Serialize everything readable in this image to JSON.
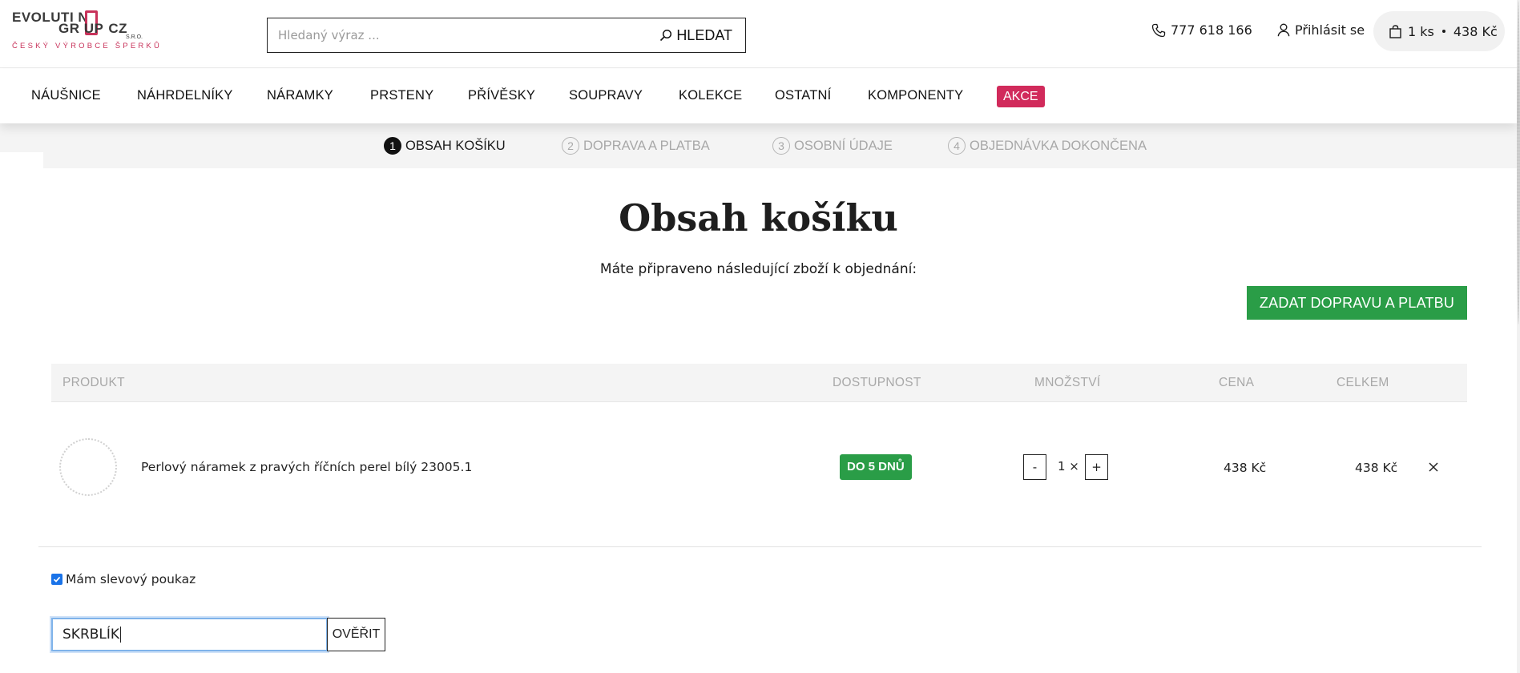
{
  "header": {
    "logo": {
      "line1": "EVOLUTI N",
      "line2_a": "GR UP",
      "line2_b": "CZ",
      "sro": "S.R.O.",
      "tagline": "ČESKÝ VÝROBCE ŠPERKŮ"
    },
    "search": {
      "placeholder": "Hledaný výraz ...",
      "value": "",
      "button_label": "HLEDAT"
    },
    "phone": "777 618 166",
    "login_label": "Přihlásit se",
    "cart": {
      "count": "1 ks",
      "total": "438 Kč"
    }
  },
  "nav": {
    "items": [
      "NÁUŠNICE",
      "NÁHRDELNÍKY",
      "NÁRAMKY",
      "PRSTENY",
      "PŘÍVĚSKY",
      "SOUPRAVY",
      "KOLEKCE",
      "OSTATNÍ",
      "KOMPONENTY"
    ],
    "sale_label": "AKCE"
  },
  "steps": [
    {
      "num": "1",
      "label": "OBSAH KOŠÍKU",
      "active": true
    },
    {
      "num": "2",
      "label": "DOPRAVA A PLATBA",
      "active": false
    },
    {
      "num": "3",
      "label": "OSOBNÍ ÚDAJE",
      "active": false
    },
    {
      "num": "4",
      "label": "OBJEDNÁVKA DOKONČENA",
      "active": false
    }
  ],
  "main": {
    "title": "Obsah košíku",
    "subtitle": "Máte připraveno následující zboží k objednání:",
    "cta_label": "ZADAT DOPRAVU A PLATBU"
  },
  "table": {
    "headers": {
      "product": "PRODUKT",
      "availability": "DOSTUPNOST",
      "quantity": "MNOŽSTVÍ",
      "price": "CENA",
      "total": "CELKEM"
    },
    "rows": [
      {
        "name": "Perlový náramek z pravých říčních perel bílý 23005.1",
        "availability": "DO 5 DNŮ",
        "qty_minus": "-",
        "qty": "1 ×",
        "qty_plus": "+",
        "price": "438 Kč",
        "total": "438 Kč"
      }
    ]
  },
  "voucher": {
    "checkbox_label": "Mám slevový poukaz",
    "checked": true,
    "input_value": "SKRBLÍK",
    "verify_label": "OVĚŘIT"
  },
  "colors": {
    "brand": "#c8325a",
    "sale": "#d12a5b",
    "green": "#2a9d47",
    "checkbox": "#1a73e8"
  }
}
